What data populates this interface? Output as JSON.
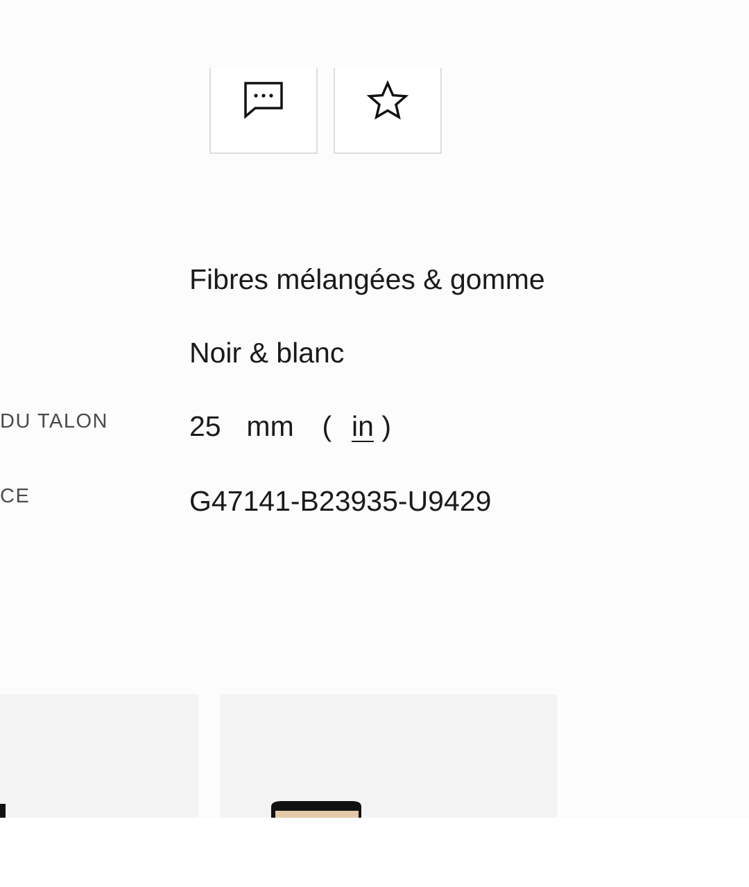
{
  "actions": {
    "contact_icon": "chat-bubble-icon",
    "wishlist_icon": "star-icon"
  },
  "specs": {
    "material": {
      "value": "Fibres mélangées & gomme"
    },
    "color": {
      "value": "Noir & blanc"
    },
    "heel": {
      "label": "DU TALON",
      "value": "25",
      "unit": "mm",
      "alt_unit_open": "(",
      "alt_unit": "in",
      "alt_unit_close": ")"
    },
    "reference": {
      "label": "CE",
      "value": "G47141-B23935-U9429"
    }
  },
  "colors": {
    "background": "#fcfcfc",
    "border": "#dddddd",
    "text": "#1a1a1a",
    "label": "#4a4a4a",
    "card_bg": "#f3f3f3"
  }
}
